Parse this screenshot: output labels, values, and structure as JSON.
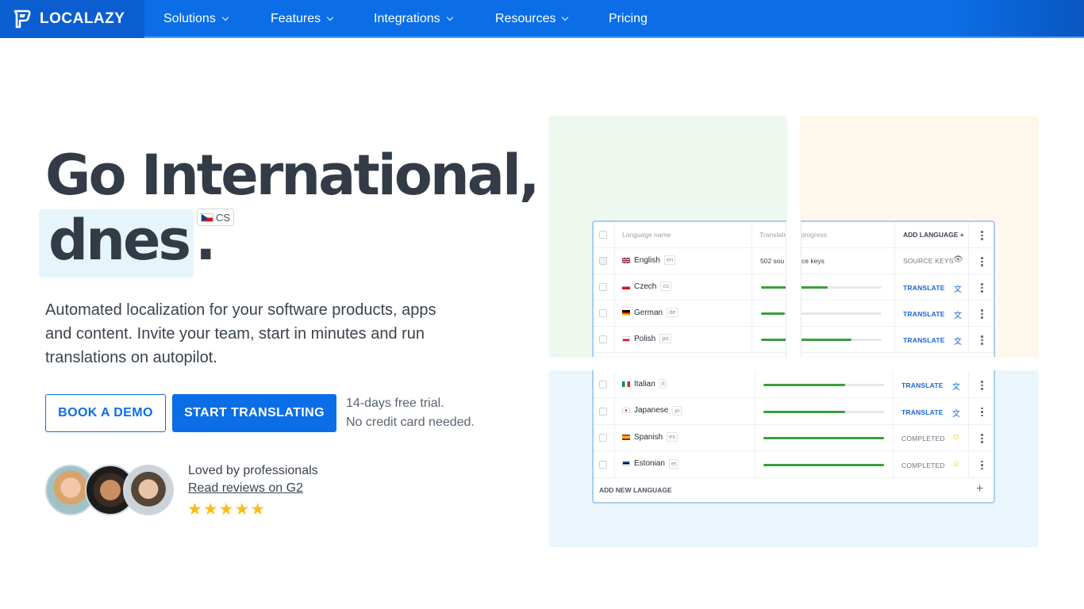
{
  "nav": {
    "brand": "LOCALAZY",
    "items": [
      {
        "label": "Solutions",
        "dropdown": true
      },
      {
        "label": "Features",
        "dropdown": true
      },
      {
        "label": "Integrations",
        "dropdown": true
      },
      {
        "label": "Resources",
        "dropdown": true
      },
      {
        "label": "Pricing",
        "dropdown": false
      }
    ]
  },
  "hero": {
    "title_line1": "Go International,",
    "title_word": "dnes",
    "title_dot": ".",
    "lang_badge": "CS",
    "subtitle": "Automated localization for your software products, apps and content. Invite your team, start in minutes and run translations on autopilot.",
    "cta_demo": "BOOK A DEMO",
    "cta_start": "START TRANSLATING",
    "trial_line1": "14-days free trial.",
    "trial_line2": "No credit card needed.",
    "social_loved": "Loved by professionals",
    "social_link": "Read reviews on G2",
    "rating_stars": 5
  },
  "mockup": {
    "header": {
      "col_language": "Language name",
      "col_translation": "Translatio",
      "col_progress": "progress",
      "add_language": "ADD LANGUAGE"
    },
    "source_row": {
      "name": "English",
      "code": "en",
      "info_left": "502 sou",
      "info_right": "ce keys",
      "action": "SOURCE KEYS"
    },
    "rows_top": [
      {
        "name": "Czech",
        "code": "cs",
        "progress": 0.55,
        "action": "TRANSLATE"
      },
      {
        "name": "German",
        "code": "de",
        "progress": 0.2,
        "action": "TRANSLATE"
      },
      {
        "name": "Polish",
        "code": "po",
        "progress": 0.75,
        "action": "TRANSLATE"
      }
    ],
    "rows_bottom": [
      {
        "name": "Italian",
        "code": "it",
        "progress": 0.68,
        "action": "TRANSLATE"
      },
      {
        "name": "Japanese",
        "code": "jo",
        "progress": 0.68,
        "action": "TRANSLATE"
      },
      {
        "name": "Spanish",
        "code": "es",
        "progress": 1.0,
        "action": "COMPLETED"
      },
      {
        "name": "Estonian",
        "code": "et",
        "progress": 1.0,
        "action": "COMPLETED"
      }
    ],
    "add_new_language": "ADD NEW LANGUAGE"
  },
  "colors": {
    "brand_blue": "#0b6ee6",
    "progress_green": "#3b9e3b",
    "star_yellow": "#f7bd1c"
  }
}
